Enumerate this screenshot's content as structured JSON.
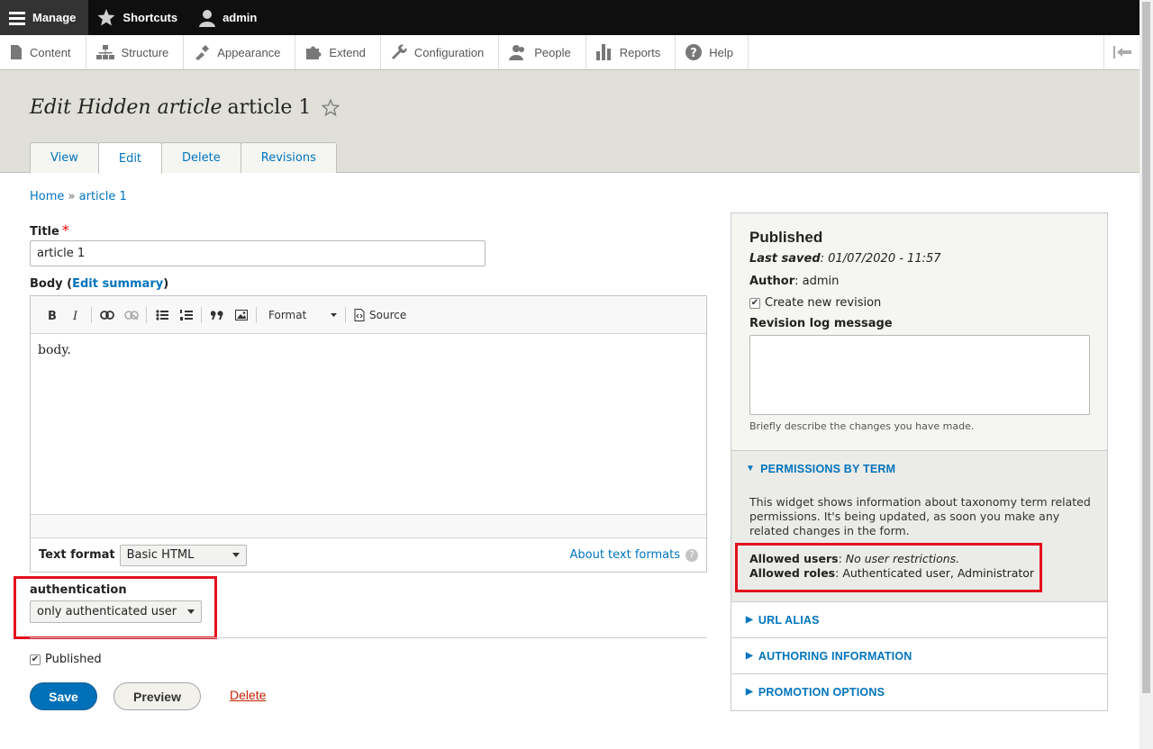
{
  "toolbar": {
    "manage": "Manage",
    "shortcuts": "Shortcuts",
    "user": "admin"
  },
  "tray": {
    "items": [
      "Content",
      "Structure",
      "Appearance",
      "Extend",
      "Configuration",
      "People",
      "Reports",
      "Help"
    ]
  },
  "page": {
    "title_italic": "Edit Hidden article",
    "title_rest": "article 1",
    "tabs": [
      "View",
      "Edit",
      "Delete",
      "Revisions"
    ],
    "active_tab": "Edit",
    "breadcrumb": [
      "Home",
      "»",
      "article 1"
    ]
  },
  "form": {
    "title_label": "Title",
    "required_marker": "*",
    "title_value": "article 1",
    "body_label_prefix": "Body (",
    "body_edit_summary": "Edit summary",
    "body_label_suffix": ")",
    "editor": {
      "format_label": "Format",
      "source_label": "Source",
      "content": "body."
    },
    "text_format_label": "Text format",
    "text_format_value": "Basic HTML",
    "about_text_formats": "About text formats",
    "help_glyph": "?",
    "authentication_label": "authentication",
    "authentication_value": "only authenticated user",
    "published_label": "Published",
    "save": "Save",
    "preview": "Preview",
    "delete": "Delete"
  },
  "sidebar": {
    "status": "Published",
    "last_saved_label": "Last saved",
    "last_saved_value": "01/07/2020 - 11:57",
    "author_label": "Author",
    "author_value": "admin",
    "create_revision": "Create new revision",
    "revision_log_label": "Revision log message",
    "revision_log_desc": "Briefly describe the changes you have made.",
    "permissions_title": "PERMISSIONS BY TERM",
    "permissions_text": "This widget shows information about taxonomy term related permissions. It's being updated, as soon you make any related changes in the form.",
    "allowed_users_label": "Allowed users",
    "allowed_users_value": "No user restrictions.",
    "allowed_roles_label": "Allowed roles",
    "allowed_roles_value": "Authenticated user, Administrator",
    "url_alias": "URL ALIAS",
    "authoring_info": "AUTHORING INFORMATION",
    "promotion_options": "PROMOTION OPTIONS"
  },
  "colors": {
    "link": "#0074bd",
    "primary_button": "#0071b8",
    "highlight_box": "#e3101f",
    "danger_link": "#c72100"
  }
}
